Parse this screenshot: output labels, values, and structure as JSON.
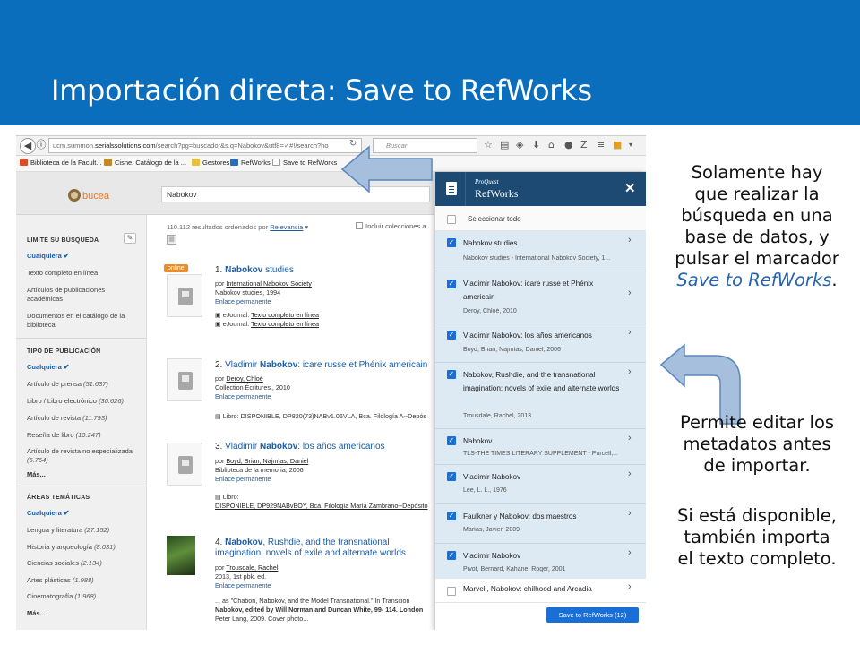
{
  "slide": {
    "title": "Importación directa: Save to RefWorks",
    "note1_line1": "Solamente hay",
    "note1_line2": "que realizar la",
    "note1_line3": "búsqueda en una",
    "note1_line4": "base de datos, y",
    "note1_line5": "pulsar el marcador",
    "note1_emph": "Save to RefWorks",
    "note1_end": ".",
    "note2_line1": "Permite editar los",
    "note2_line2": "metadatos antes",
    "note2_line3": "de importar.",
    "note3_line1": "Si está disponible,",
    "note3_line2": "también importa",
    "note3_line3": "el texto completo.",
    "banner_color": "#0a6ebd",
    "arrow_color": "#a6bfdd"
  },
  "browser": {
    "url_prefix": "ucm.summon.",
    "url_domain": "serialssolutions.com",
    "url_rest": "/search?pg=buscador&s.q=Nabokov&utf8=✓#!/search?ho",
    "search_placeholder": "Buscar",
    "bookmarks": [
      "Biblioteca de la Facult...",
      "Cisne. Catálogo de la ...",
      "Gestores",
      "RefWorks",
      "Save to RefWorks"
    ]
  },
  "site": {
    "logo_text": "bucea",
    "search_value": "Nabokov"
  },
  "sidebar": {
    "limit_heading": "LIMITE SU BÚSQUEDA",
    "limit_selected": "Cualquiera",
    "limit_items": [
      "Texto completo en línea",
      "Artículos de publicaciones académicas",
      "Documentos en el catálogo de la biblioteca"
    ],
    "type_heading": "TIPO DE PUBLICACIÓN",
    "type_selected": "Cualquiera",
    "type_items": [
      {
        "label": "Artículo de prensa",
        "count": "(51.637)"
      },
      {
        "label": "Libro / Libro electrónico",
        "count": "(30.626)"
      },
      {
        "label": "Artículo de revista",
        "count": "(11.793)"
      },
      {
        "label": "Reseña de libro",
        "count": "(10.247)"
      },
      {
        "label": "Artículo de revista no especializada",
        "count": "(5.764)"
      }
    ],
    "more": "Más...",
    "areas_heading": "ÁREAS TEMÁTICAS",
    "areas_selected": "Cualquiera",
    "area_items": [
      {
        "label": "Lengua y literatura",
        "count": "(27.152)"
      },
      {
        "label": "Historia y arqueología",
        "count": "(8.031)"
      },
      {
        "label": "Ciencias sociales",
        "count": "(2.134)"
      },
      {
        "label": "Artes plásticas",
        "count": "(1.988)"
      },
      {
        "label": "Cinematografía",
        "count": "(1.968)"
      }
    ],
    "more2": "Más..."
  },
  "results": {
    "count_text": "110.112 resultados ordenados por",
    "sort_label": "Relevancia",
    "include_label": "Incluir colecciones a",
    "online_badge": "online",
    "items": [
      {
        "num": "1.",
        "title_bold": "Nabokov",
        "title_rest": " studies",
        "meta1_pre": "por ",
        "meta1_link": "International Nabokov Society",
        "meta2": "Nabokov studies, 1994",
        "permalink": "Enlace permanente",
        "ej1_pre": "eJournal: ",
        "ej1_link": "Texto completo en línea",
        "ej2_pre": "eJournal: ",
        "ej2_link": "Texto completo en línea"
      },
      {
        "num": "2.",
        "title_pre": "Vladimir ",
        "title_bold": "Nabokov",
        "title_rest": ": icare russe et Phénix americain",
        "meta1_pre": "por ",
        "meta1_link": "Deroy, Chloé",
        "meta2": "Collection Écritures., 2010",
        "permalink": "Enlace permanente",
        "book": "Libro: DISPONIBLE, DP820(73)NABv1.06VLA, Bca. Filología A--Depós"
      },
      {
        "num": "3.",
        "title_pre": "Vladimir ",
        "title_bold": "Nabokov",
        "title_rest": ": los años americanos",
        "meta1_pre": "por ",
        "meta1_link": "Boyd, Brian; Najmías, Daniel",
        "meta2": "Biblioteca de la memoria, 2006",
        "permalink": "Enlace permanente",
        "book1": "Libro:",
        "book2": "DISPONIBLE, DP929NABvBOY, Bca. Filología María Zambrano--Depósito"
      },
      {
        "num": "4.",
        "title_bold": "Nabokov",
        "title_rest": ", Rushdie, and the transnational imagination: novels of exile and alternate worlds",
        "meta1_pre": "por ",
        "meta1_link": "Trousdale, Rachel",
        "meta2": "2013, 1st pbk. ed.",
        "permalink": "Enlace permanente",
        "snip1": "... as \"Chabon, Nabokov, and the Model Transnational.\" In Transition",
        "snip2": "Nabokov, edited by Will Norman and Duncan White, 99- 114. London",
        "snip3": "Peter Lang, 2009. Cover photo..."
      }
    ]
  },
  "refworks": {
    "proquest": "ProQuest",
    "brand": "RefWorks",
    "close": "✕",
    "select_all": "Seleccionar todo",
    "items": [
      {
        "title": "Nabokov studies",
        "sub": "Nabokov studies - International Nabokov Society, 1..."
      },
      {
        "title": "Vladimir Nabokov: icare russe et Phénix americain",
        "sub": "Deroy, Chloé, 2010"
      },
      {
        "title": "Vladimir Nabokov: los años americanos",
        "sub": "Boyd, Brian, Najmías, Daniel, 2006"
      },
      {
        "title": "Nabokov, Rushdie, and the transnational imagination: novels of exile and alternate worlds",
        "sub": "Trousdale, Rachel, 2013"
      },
      {
        "title": "Nabokov",
        "sub": "TLS-THE TIMES LITERARY SUPPLEMENT - Purcell,..."
      },
      {
        "title": "Vladimir Nabokov",
        "sub": "Lee, L. L., 1976"
      },
      {
        "title": "Faulkner y Nabokov: dos maestros",
        "sub": "Marías, Javier, 2009"
      },
      {
        "title": "Vladimir Nabokov",
        "sub": "Pivot, Bernard, Kahane, Roger, 2001"
      }
    ],
    "last_item": "Marvell, Nabokov: chilhood and Arcadia",
    "save_button": "Save to RefWorks (12)"
  }
}
